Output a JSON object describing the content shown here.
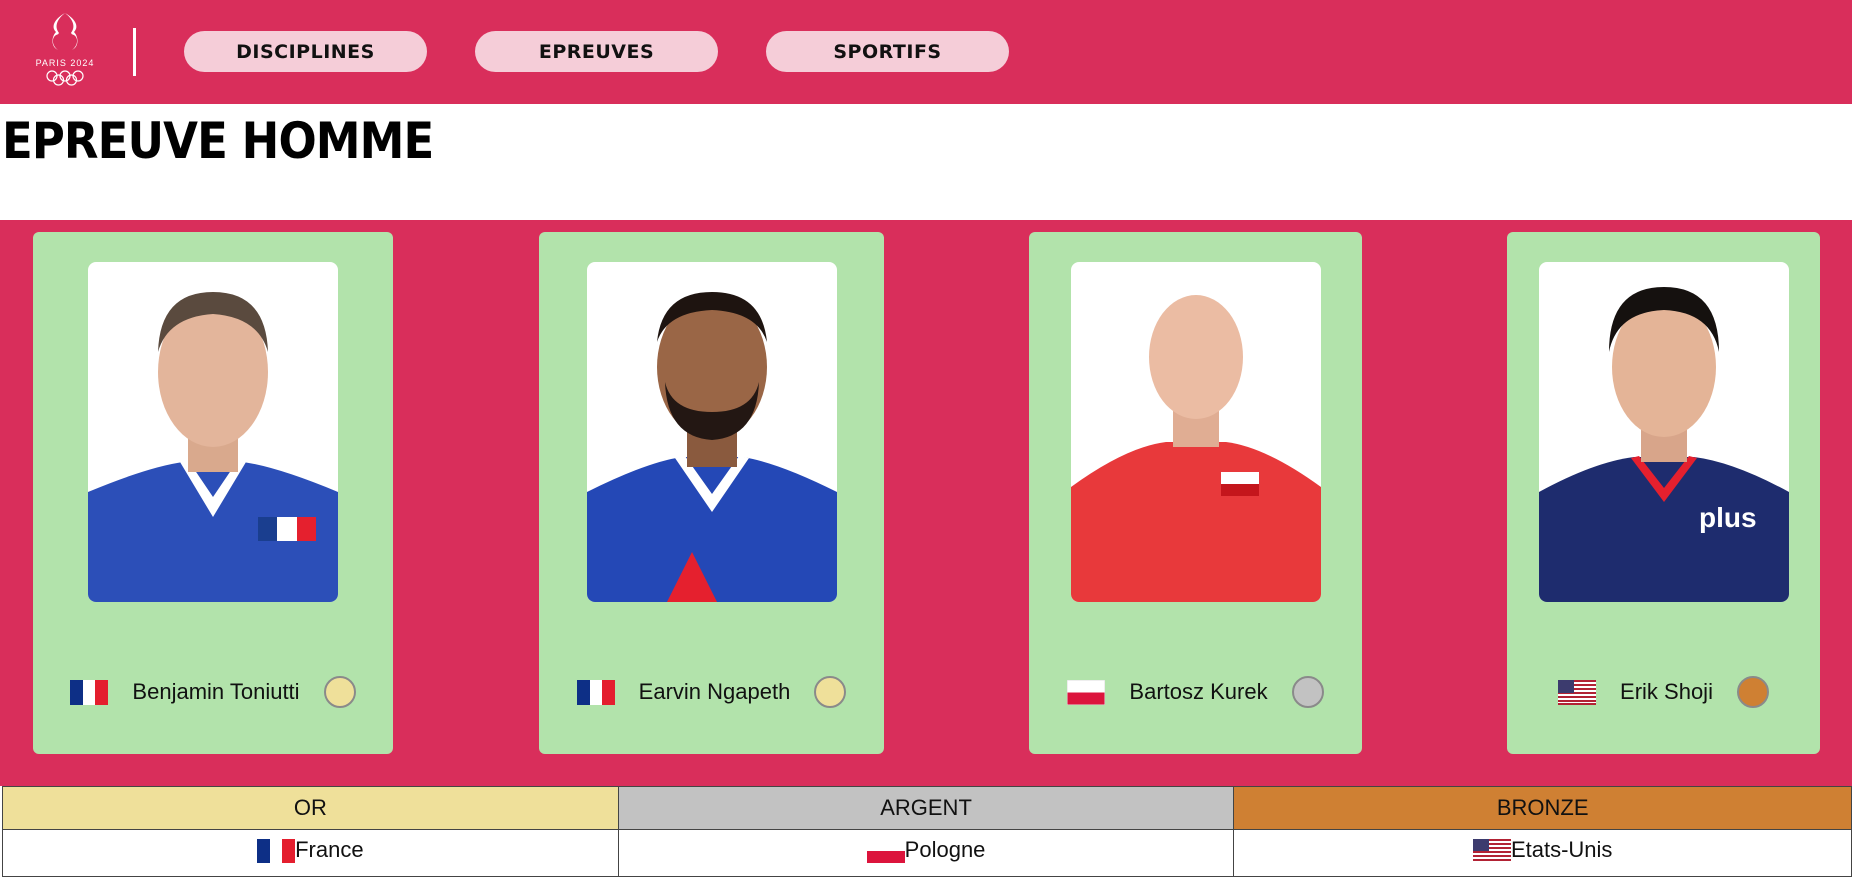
{
  "header": {
    "logo_text": "PARIS 2024",
    "nav": [
      {
        "label": "DISCIPLINES"
      },
      {
        "label": "EPREUVES"
      },
      {
        "label": "SPORTIFS"
      }
    ]
  },
  "page_title": "EPREUVE HOMME",
  "athletes": [
    {
      "name": "Benjamin Toniutti",
      "country_flag": "france-flag-icon",
      "medal": "gold",
      "jersey_color": "#2c4fb8"
    },
    {
      "name": "Earvin Ngapeth",
      "country_flag": "france-flag-icon",
      "medal": "gold",
      "jersey_color": "#2448b6"
    },
    {
      "name": "Bartosz Kurek",
      "country_flag": "poland-flag-icon",
      "medal": "silver",
      "jersey_color": "#e8393b"
    },
    {
      "name": "Erik Shoji",
      "country_flag": "usa-flag-icon",
      "medal": "bronze",
      "jersey_color": "#1e2c6e"
    }
  ],
  "medal_colors": {
    "gold": "#efe09a",
    "silver": "#c2c2c2",
    "bronze": "#cf8033"
  },
  "podium": {
    "headers": [
      "OR",
      "ARGENT",
      "BRONZE"
    ],
    "countries": [
      "France",
      "Pologne",
      "Etats-Unis"
    ]
  },
  "colors": {
    "brand": "#d92e5b",
    "card": "#b2e3ab",
    "nav_pill": "#f5cdd8"
  }
}
